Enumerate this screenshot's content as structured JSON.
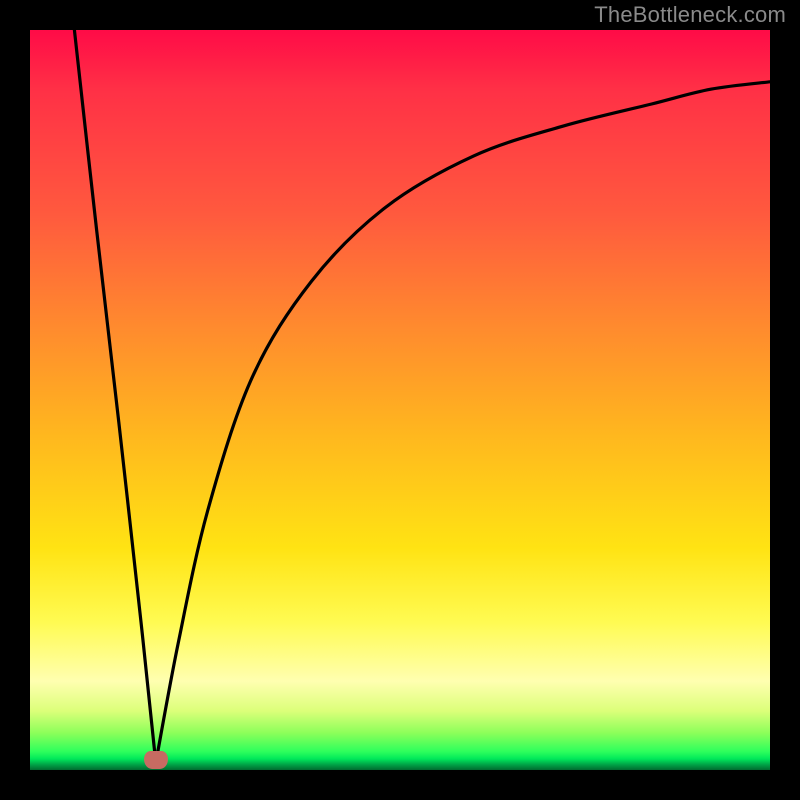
{
  "watermark": "TheBottleneck.com",
  "chart_data": {
    "type": "line",
    "title": "",
    "xlabel": "",
    "ylabel": "",
    "grid": false,
    "xlim": [
      0,
      100
    ],
    "ylim": [
      0,
      100
    ],
    "note": "Backdrop is a vertical colour gradient acting as a heat scale (red at top ≈ high bottleneck, green at bottom ≈ balanced). The black curve is roughly |score − x| shaped: it drops from ~100 at x≈6 to ~1 at x≈17 (the marker), then rises asymptotically toward ~93 at x=100. Values below are estimated from pixel positions.",
    "series": [
      {
        "name": "bottleneck-curve",
        "x": [
          6,
          9,
          12,
          15,
          17,
          20,
          24,
          30,
          38,
          48,
          60,
          72,
          84,
          92,
          100
        ],
        "y": [
          100,
          73,
          47,
          20,
          1,
          17,
          35,
          53,
          66,
          76,
          83,
          87,
          90,
          92,
          93
        ]
      }
    ],
    "marker": {
      "x": 17,
      "y": 1,
      "color": "#c76b62"
    },
    "gradient_stops": [
      {
        "pos": 0.0,
        "color": "#ff0b47"
      },
      {
        "pos": 0.25,
        "color": "#ff5a3e"
      },
      {
        "pos": 0.55,
        "color": "#ffb81e"
      },
      {
        "pos": 0.8,
        "color": "#fffb52"
      },
      {
        "pos": 0.95,
        "color": "#8cff5a"
      },
      {
        "pos": 1.0,
        "color": "#006b2f"
      }
    ]
  }
}
